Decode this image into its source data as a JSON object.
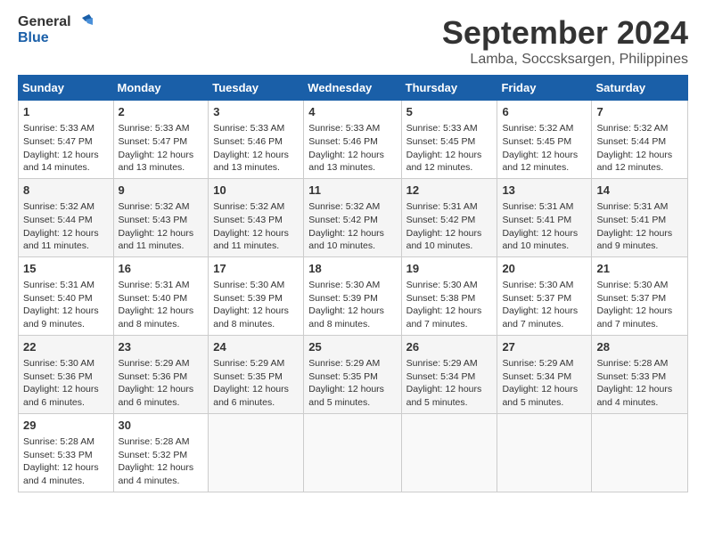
{
  "logo": {
    "line1": "General",
    "line2": "Blue"
  },
  "title": "September 2024",
  "location": "Lamba, Soccsksargen, Philippines",
  "weekdays": [
    "Sunday",
    "Monday",
    "Tuesday",
    "Wednesday",
    "Thursday",
    "Friday",
    "Saturday"
  ],
  "weeks": [
    [
      {
        "day": 1,
        "sunrise": "5:33 AM",
        "sunset": "5:47 PM",
        "daylight": "12 hours and 14 minutes."
      },
      {
        "day": 2,
        "sunrise": "5:33 AM",
        "sunset": "5:47 PM",
        "daylight": "12 hours and 13 minutes."
      },
      {
        "day": 3,
        "sunrise": "5:33 AM",
        "sunset": "5:46 PM",
        "daylight": "12 hours and 13 minutes."
      },
      {
        "day": 4,
        "sunrise": "5:33 AM",
        "sunset": "5:46 PM",
        "daylight": "12 hours and 13 minutes."
      },
      {
        "day": 5,
        "sunrise": "5:33 AM",
        "sunset": "5:45 PM",
        "daylight": "12 hours and 12 minutes."
      },
      {
        "day": 6,
        "sunrise": "5:32 AM",
        "sunset": "5:45 PM",
        "daylight": "12 hours and 12 minutes."
      },
      {
        "day": 7,
        "sunrise": "5:32 AM",
        "sunset": "5:44 PM",
        "daylight": "12 hours and 12 minutes."
      }
    ],
    [
      {
        "day": 8,
        "sunrise": "5:32 AM",
        "sunset": "5:44 PM",
        "daylight": "12 hours and 11 minutes."
      },
      {
        "day": 9,
        "sunrise": "5:32 AM",
        "sunset": "5:43 PM",
        "daylight": "12 hours and 11 minutes."
      },
      {
        "day": 10,
        "sunrise": "5:32 AM",
        "sunset": "5:43 PM",
        "daylight": "12 hours and 11 minutes."
      },
      {
        "day": 11,
        "sunrise": "5:32 AM",
        "sunset": "5:42 PM",
        "daylight": "12 hours and 10 minutes."
      },
      {
        "day": 12,
        "sunrise": "5:31 AM",
        "sunset": "5:42 PM",
        "daylight": "12 hours and 10 minutes."
      },
      {
        "day": 13,
        "sunrise": "5:31 AM",
        "sunset": "5:41 PM",
        "daylight": "12 hours and 10 minutes."
      },
      {
        "day": 14,
        "sunrise": "5:31 AM",
        "sunset": "5:41 PM",
        "daylight": "12 hours and 9 minutes."
      }
    ],
    [
      {
        "day": 15,
        "sunrise": "5:31 AM",
        "sunset": "5:40 PM",
        "daylight": "12 hours and 9 minutes."
      },
      {
        "day": 16,
        "sunrise": "5:31 AM",
        "sunset": "5:40 PM",
        "daylight": "12 hours and 8 minutes."
      },
      {
        "day": 17,
        "sunrise": "5:30 AM",
        "sunset": "5:39 PM",
        "daylight": "12 hours and 8 minutes."
      },
      {
        "day": 18,
        "sunrise": "5:30 AM",
        "sunset": "5:39 PM",
        "daylight": "12 hours and 8 minutes."
      },
      {
        "day": 19,
        "sunrise": "5:30 AM",
        "sunset": "5:38 PM",
        "daylight": "12 hours and 7 minutes."
      },
      {
        "day": 20,
        "sunrise": "5:30 AM",
        "sunset": "5:37 PM",
        "daylight": "12 hours and 7 minutes."
      },
      {
        "day": 21,
        "sunrise": "5:30 AM",
        "sunset": "5:37 PM",
        "daylight": "12 hours and 7 minutes."
      }
    ],
    [
      {
        "day": 22,
        "sunrise": "5:30 AM",
        "sunset": "5:36 PM",
        "daylight": "12 hours and 6 minutes."
      },
      {
        "day": 23,
        "sunrise": "5:29 AM",
        "sunset": "5:36 PM",
        "daylight": "12 hours and 6 minutes."
      },
      {
        "day": 24,
        "sunrise": "5:29 AM",
        "sunset": "5:35 PM",
        "daylight": "12 hours and 6 minutes."
      },
      {
        "day": 25,
        "sunrise": "5:29 AM",
        "sunset": "5:35 PM",
        "daylight": "12 hours and 5 minutes."
      },
      {
        "day": 26,
        "sunrise": "5:29 AM",
        "sunset": "5:34 PM",
        "daylight": "12 hours and 5 minutes."
      },
      {
        "day": 27,
        "sunrise": "5:29 AM",
        "sunset": "5:34 PM",
        "daylight": "12 hours and 5 minutes."
      },
      {
        "day": 28,
        "sunrise": "5:28 AM",
        "sunset": "5:33 PM",
        "daylight": "12 hours and 4 minutes."
      }
    ],
    [
      {
        "day": 29,
        "sunrise": "5:28 AM",
        "sunset": "5:33 PM",
        "daylight": "12 hours and 4 minutes."
      },
      {
        "day": 30,
        "sunrise": "5:28 AM",
        "sunset": "5:32 PM",
        "daylight": "12 hours and 4 minutes."
      },
      null,
      null,
      null,
      null,
      null
    ]
  ]
}
